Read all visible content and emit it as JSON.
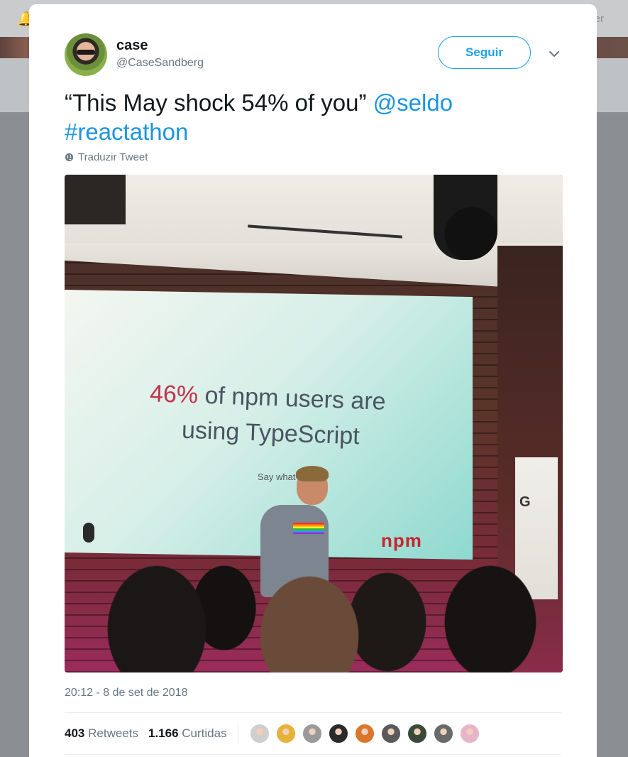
{
  "background": {
    "right_text": "er"
  },
  "tweet": {
    "author": {
      "name": "case",
      "handle": "@CaseSandberg"
    },
    "follow_label": "Seguir",
    "text_plain": "“This May shock 54% of you” ",
    "mention": "@seldo",
    "hashtag": "#reactathon",
    "translate_label": "Traduzir Tweet",
    "timestamp": "20:12 - 8 de set de 2018",
    "stats": {
      "retweets_count": "403",
      "retweets_label": "Retweets",
      "likes_count": "1.166",
      "likes_label": "Curtidas"
    },
    "likers": [
      {
        "color": "#cfcfcf"
      },
      {
        "color": "#e7b23a"
      },
      {
        "color": "#9a9a9a"
      },
      {
        "color": "#2a2a2a"
      },
      {
        "color": "#d9772a"
      },
      {
        "color": "#5a5a5a"
      },
      {
        "color": "#3a4a3a"
      },
      {
        "color": "#6a6a6a"
      },
      {
        "color": "#e8b4c8"
      }
    ]
  },
  "photo": {
    "slide_pct": "46%",
    "slide_line1_rest": " of npm users are",
    "slide_line2": "using TypeScript",
    "slide_line3": "Say what?",
    "slide_logo": "npm",
    "banner_text": "G"
  },
  "colors": {
    "link": "#1b95e0",
    "brand": "#1da1f2",
    "muted": "#657786"
  }
}
